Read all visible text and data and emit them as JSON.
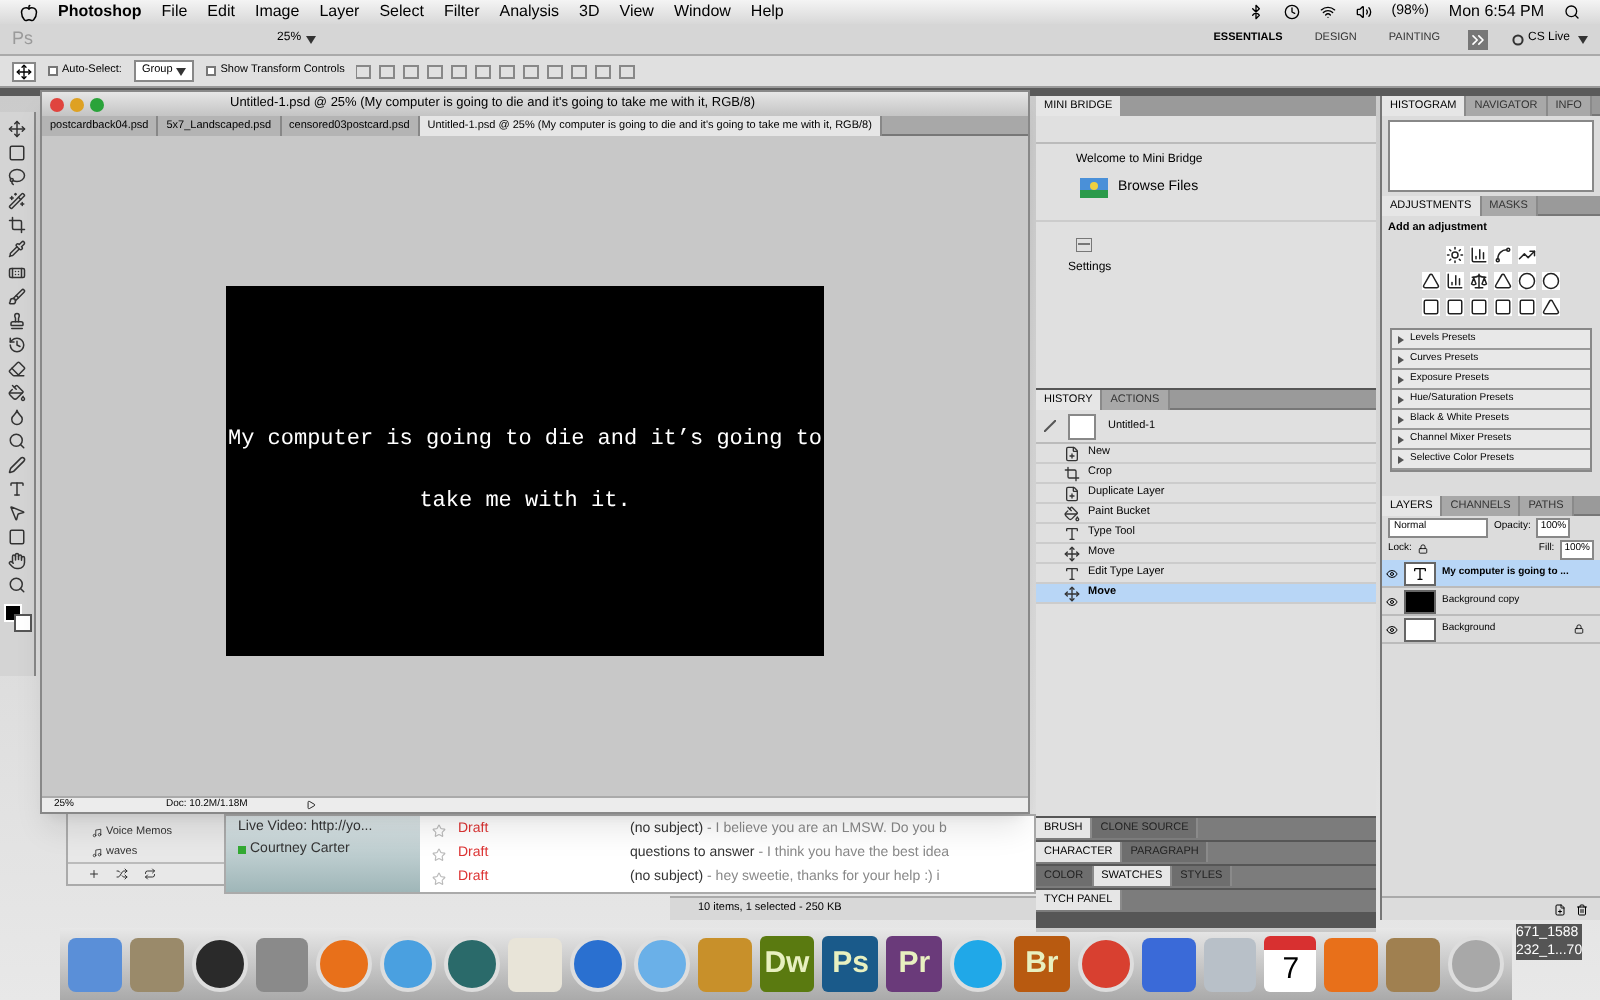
{
  "menubar": {
    "app": "Photoshop",
    "menus": [
      "File",
      "Edit",
      "Image",
      "Layer",
      "Select",
      "Filter",
      "Analysis",
      "3D",
      "View",
      "Window",
      "Help"
    ],
    "battery": "(98%)",
    "clock": "Mon 6:54 PM"
  },
  "app_bar": {
    "logo": "Ps",
    "zoom": "25%",
    "workspaces": [
      {
        "label": "ESSENTIALS",
        "selected": true
      },
      {
        "label": "DESIGN",
        "selected": false
      },
      {
        "label": "PAINTING",
        "selected": false
      }
    ],
    "cs_live": "CS Live"
  },
  "options_bar": {
    "auto_select": {
      "label": "Auto-Select:",
      "checked": false
    },
    "auto_select_value": "Group",
    "transform": {
      "label": "Show Transform Controls",
      "checked": false
    }
  },
  "document": {
    "title": "Untitled-1.psd @ 25% (My computer is going to die and it's going to  take me with it, RGB/8)",
    "tabs": [
      {
        "label": "postcardback04.psd",
        "selected": false
      },
      {
        "label": "5x7_Landscaped.psd",
        "selected": false
      },
      {
        "label": "censored03postcard.psd",
        "selected": false
      },
      {
        "label": "Untitled-1.psd @ 25% (My computer is going to die and it's going to  take me with it, RGB/8)",
        "selected": true
      }
    ],
    "canvas_lines": [
      "My computer is going to die and it’s going to",
      "take me with it."
    ],
    "zoom": "25%",
    "doc_size": "Doc: 10.2M/1.18M"
  },
  "mini_bridge": {
    "title": "MINI BRIDGE",
    "welcome": "Welcome to Mini Bridge",
    "browse": "Browse Files",
    "settings": "Settings"
  },
  "history": {
    "tabs": [
      {
        "label": "HISTORY",
        "selected": true
      },
      {
        "label": "ACTIONS",
        "selected": false
      }
    ],
    "snapshot": "Untitled-1",
    "items": [
      {
        "label": "New",
        "kind": "document",
        "selected": false
      },
      {
        "label": "Crop",
        "kind": "crop",
        "selected": false
      },
      {
        "label": "Duplicate Layer",
        "kind": "document",
        "selected": false
      },
      {
        "label": "Paint Bucket",
        "kind": "bucket",
        "selected": false
      },
      {
        "label": "Type Tool",
        "kind": "type",
        "selected": false
      },
      {
        "label": "Move",
        "kind": "move",
        "selected": false
      },
      {
        "label": "Edit Type Layer",
        "kind": "type",
        "selected": false
      },
      {
        "label": "Move",
        "kind": "move",
        "selected": true
      }
    ]
  },
  "collapsed_panels": [
    {
      "tabs": [
        {
          "label": "BRUSH",
          "selected": true
        },
        {
          "label": "CLONE SOURCE",
          "selected": false
        }
      ]
    },
    {
      "tabs": [
        {
          "label": "CHARACTER",
          "selected": true
        },
        {
          "label": "PARAGRAPH",
          "selected": false
        }
      ]
    },
    {
      "tabs": [
        {
          "label": "COLOR",
          "selected": false
        },
        {
          "label": "SWATCHES",
          "selected": true
        },
        {
          "label": "STYLES",
          "selected": false
        }
      ]
    },
    {
      "tabs": [
        {
          "label": "TYCH PANEL",
          "selected": true
        }
      ]
    }
  ],
  "histogram": {
    "tabs": [
      {
        "label": "HISTOGRAM",
        "selected": true
      },
      {
        "label": "NAVIGATOR",
        "selected": false
      },
      {
        "label": "INFO",
        "selected": false
      }
    ]
  },
  "adjustments": {
    "tabs": [
      {
        "label": "ADJUSTMENTS",
        "selected": true
      },
      {
        "label": "MASKS",
        "selected": false
      }
    ],
    "hint": "Add an adjustment",
    "presets": [
      "Levels Presets",
      "Curves Presets",
      "Exposure Presets",
      "Hue/Saturation Presets",
      "Black & White Presets",
      "Channel Mixer Presets",
      "Selective Color Presets"
    ]
  },
  "layers": {
    "tabs": [
      {
        "label": "LAYERS",
        "selected": true
      },
      {
        "label": "CHANNELS",
        "selected": false
      },
      {
        "label": "PATHS",
        "selected": false
      }
    ],
    "blend_mode": "Normal",
    "opacity_label": "Opacity:",
    "opacity": "100%",
    "lock_label": "Lock:",
    "fill_label": "Fill:",
    "fill": "100%",
    "items": [
      {
        "name": "My computer is going to ...",
        "kind": "text",
        "selected": true,
        "locked": false
      },
      {
        "name": "Background copy",
        "kind": "black",
        "selected": false,
        "locked": false
      },
      {
        "name": "Background",
        "kind": "white",
        "selected": false,
        "locked": true
      }
    ]
  },
  "background_apps": {
    "playlists": [
      "Voice Memos",
      "waves"
    ],
    "chat": {
      "video": "Live Video: http://yo...",
      "contact": "Courtney Carter"
    },
    "mail_rows": [
      {
        "status": "Draft",
        "subject": "(no subject)",
        "snippet": " - I believe you are an LMSW. Do you b"
      },
      {
        "status": "Draft",
        "subject": "questions to answer",
        "snippet": " - I think you have the best idea"
      },
      {
        "status": "Draft",
        "subject": "(no subject)",
        "snippet": " - hey sweetie, thanks for your help :) i"
      }
    ],
    "finder_status": "10 items, 1 selected - 250 KB"
  },
  "dock": {
    "items": [
      {
        "kind": "square",
        "color": "#5a8fd8"
      },
      {
        "kind": "square",
        "color": "#9a8a6a"
      },
      {
        "kind": "round",
        "color": "#2a2a2a"
      },
      {
        "kind": "square",
        "color": "#8a8a8a"
      },
      {
        "kind": "round",
        "color": "#e8701a"
      },
      {
        "kind": "round",
        "color": "#4aa0e0"
      },
      {
        "kind": "round",
        "color": "#2a6a6a"
      },
      {
        "kind": "square",
        "color": "#e8e4d8"
      },
      {
        "kind": "round",
        "color": "#2a70d0"
      },
      {
        "kind": "round",
        "color": "#6ab0e8"
      },
      {
        "kind": "square",
        "color": "#c8902a"
      },
      {
        "kind": "tile",
        "label": "Dw",
        "color": "#5a7a10"
      },
      {
        "kind": "tile",
        "label": "Ps",
        "color": "#1a5a8a"
      },
      {
        "kind": "tile",
        "label": "Pr",
        "color": "#6a3a7a"
      },
      {
        "kind": "round",
        "color": "#20a8e8"
      },
      {
        "kind": "tile",
        "label": "Br",
        "color": "#b85a10"
      },
      {
        "kind": "round",
        "color": "#d84030"
      },
      {
        "kind": "square",
        "color": "#3a6ad8"
      },
      {
        "kind": "square",
        "color": "#b8c0c8"
      },
      {
        "kind": "calendar",
        "label": "7",
        "color": "#d83030"
      },
      {
        "kind": "square",
        "color": "#e8701a"
      },
      {
        "kind": "square",
        "color": "#a08050"
      },
      {
        "kind": "round",
        "color": "#a8a8a8"
      }
    ],
    "desktop_icon_lines": [
      "671_1588",
      "232_1...70"
    ]
  }
}
